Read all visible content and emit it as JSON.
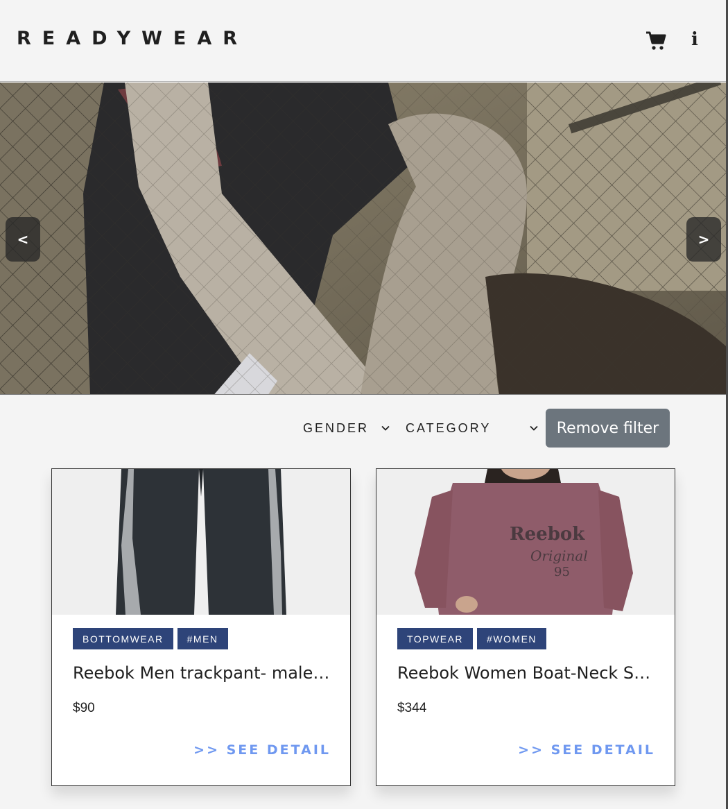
{
  "brand": "READYWEAR",
  "header": {
    "cart_icon": "cart-icon",
    "info_icon": "info-icon",
    "info_glyph": "i"
  },
  "carousel": {
    "prev_label": "<",
    "next_label": ">"
  },
  "filters": {
    "gender_label": "GENDER",
    "category_label": "CATEGORY",
    "remove_label": "Remove filter"
  },
  "products": [
    {
      "tags": [
        "BOTTOMWEAR",
        "#MEN"
      ],
      "title": "Reebok Men trackpant- male tracksuit pant",
      "price": "$90",
      "cta": ">> SEE DETAIL"
    },
    {
      "tags": [
        "TOPWEAR",
        "#WOMEN"
      ],
      "title": "Reebok Women Boat-Neck Sweatshirt",
      "price": "$344",
      "cta": ">> SEE DETAIL"
    }
  ],
  "colors": {
    "tag_bg": "#2e4479",
    "cta": "#6f98f0",
    "remove_filter_bg": "#6c757d"
  }
}
